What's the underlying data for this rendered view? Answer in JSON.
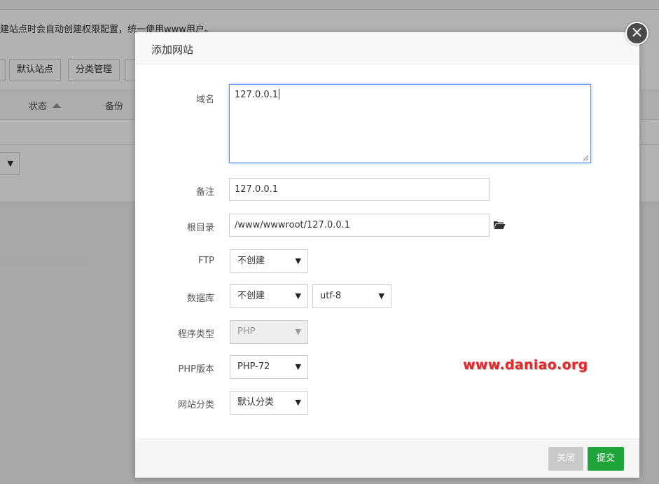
{
  "background": {
    "tip_text": "建站点时会自动创建权限配置，统一使用www用户。",
    "buttons": [
      "默认站点",
      "分类管理"
    ],
    "table_headers": {
      "status": "状态",
      "backup": "备份"
    },
    "select_arrow": "▼"
  },
  "modal": {
    "title": "添加网站",
    "close_icon": "×",
    "fields": {
      "domain": {
        "label": "域名",
        "value": "127.0.0.1"
      },
      "remark": {
        "label": "备注",
        "value": "127.0.0.1"
      },
      "root": {
        "label": "根目录",
        "value": "/www/wwwroot/127.0.0.1",
        "icon": "folder-open-icon"
      },
      "ftp": {
        "label": "FTP",
        "value": "不创建"
      },
      "database": {
        "label": "数据库",
        "value": "不创建",
        "charset": "utf-8"
      },
      "program_type": {
        "label": "程序类型",
        "value": "PHP"
      },
      "php_version": {
        "label": "PHP版本",
        "value": "PHP-72"
      },
      "site_category": {
        "label": "网站分类",
        "value": "默认分类"
      }
    },
    "select_arrow": "▼",
    "buttons": {
      "close": "关闭",
      "submit": "提交"
    }
  },
  "watermark": "www.daniao.org",
  "colors": {
    "submit": "#20a53a",
    "focus_border": "#4d90fe",
    "watermark": "#e8262a"
  }
}
